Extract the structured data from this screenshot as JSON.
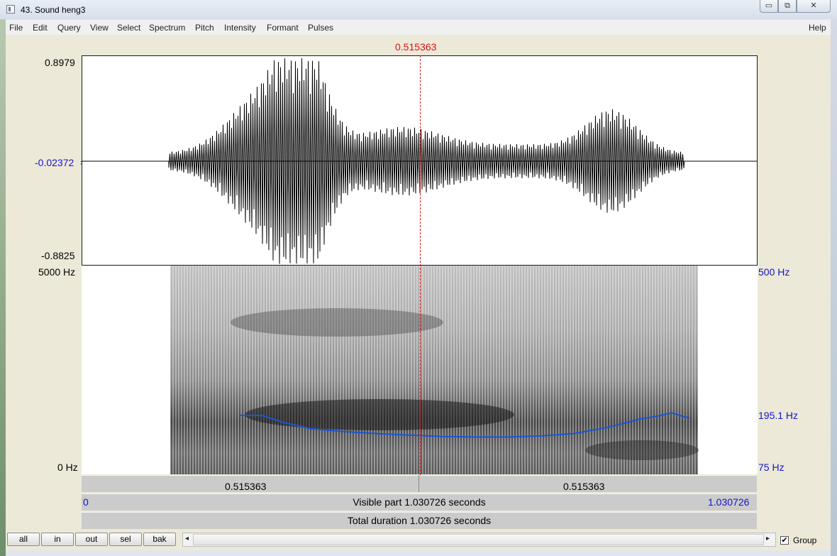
{
  "window": {
    "title": "43. Sound heng3",
    "min_glyph": "▭",
    "max_glyph": "⧉",
    "close_glyph": "✕"
  },
  "menu": {
    "items": [
      "File",
      "Edit",
      "Query",
      "View",
      "Select",
      "Spectrum",
      "Pitch",
      "Intensity",
      "Formant",
      "Pulses"
    ],
    "help": "Help"
  },
  "cursor": {
    "time_label": "0.515363",
    "time": 0.515363
  },
  "waveform": {
    "max_label": "0.8979",
    "zero_label": "-0.02372",
    "min_label": "-0.8825",
    "signal_start": 0.132,
    "signal_end": 0.918
  },
  "spectrogram": {
    "top_label": "5000 Hz",
    "bottom_label": "0 Hz",
    "pitch_top_label": "500 Hz",
    "pitch_value_label": "195.1 Hz",
    "pitch_bottom_label": "75 Hz",
    "pitch_range_hz": [
      75,
      500
    ],
    "pitch_track": [
      [
        0.24,
        195
      ],
      [
        0.275,
        195
      ],
      [
        0.31,
        180
      ],
      [
        0.35,
        168
      ],
      [
        0.4,
        162
      ],
      [
        0.45,
        158
      ],
      [
        0.5,
        155
      ],
      [
        0.55,
        152
      ],
      [
        0.6,
        151
      ],
      [
        0.65,
        151
      ],
      [
        0.7,
        153
      ],
      [
        0.75,
        158
      ],
      [
        0.8,
        170
      ],
      [
        0.85,
        187
      ],
      [
        0.88,
        194
      ],
      [
        0.9,
        200
      ],
      [
        0.92,
        192
      ],
      [
        0.927,
        190
      ]
    ]
  },
  "rulers": {
    "selection_left": "0.515363",
    "selection_right": "0.515363",
    "visible_start": "0",
    "visible_label": "Visible part 1.030726 seconds",
    "visible_end": "1.030726",
    "total_label": "Total duration 1.030726 seconds",
    "total_duration": 1.030726
  },
  "bottom": {
    "buttons": [
      "all",
      "in",
      "out",
      "sel",
      "bak"
    ],
    "scroll_left": "◂",
    "scroll_right": "▸",
    "group_label": "Group",
    "group_checked": "✔"
  },
  "colors": {
    "cursor": "#dd1111",
    "pitch": "#1a55d8",
    "axis_blue": "#1414c8"
  }
}
